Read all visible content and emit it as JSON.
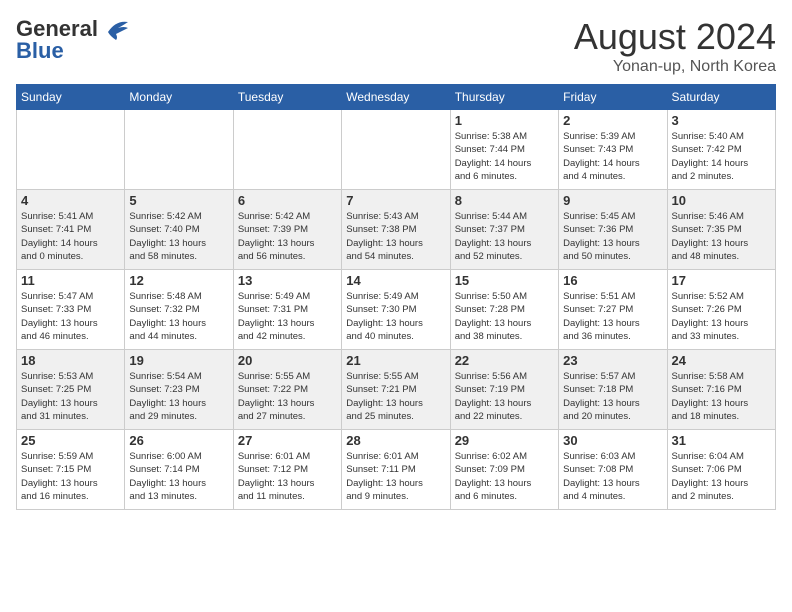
{
  "header": {
    "logo_general": "General",
    "logo_blue": "Blue",
    "month": "August 2024",
    "location": "Yonan-up, North Korea"
  },
  "weekdays": [
    "Sunday",
    "Monday",
    "Tuesday",
    "Wednesday",
    "Thursday",
    "Friday",
    "Saturday"
  ],
  "weeks": [
    [
      {
        "day": "",
        "detail": ""
      },
      {
        "day": "",
        "detail": ""
      },
      {
        "day": "",
        "detail": ""
      },
      {
        "day": "",
        "detail": ""
      },
      {
        "day": "1",
        "detail": "Sunrise: 5:38 AM\nSunset: 7:44 PM\nDaylight: 14 hours\nand 6 minutes."
      },
      {
        "day": "2",
        "detail": "Sunrise: 5:39 AM\nSunset: 7:43 PM\nDaylight: 14 hours\nand 4 minutes."
      },
      {
        "day": "3",
        "detail": "Sunrise: 5:40 AM\nSunset: 7:42 PM\nDaylight: 14 hours\nand 2 minutes."
      }
    ],
    [
      {
        "day": "4",
        "detail": "Sunrise: 5:41 AM\nSunset: 7:41 PM\nDaylight: 14 hours\nand 0 minutes."
      },
      {
        "day": "5",
        "detail": "Sunrise: 5:42 AM\nSunset: 7:40 PM\nDaylight: 13 hours\nand 58 minutes."
      },
      {
        "day": "6",
        "detail": "Sunrise: 5:42 AM\nSunset: 7:39 PM\nDaylight: 13 hours\nand 56 minutes."
      },
      {
        "day": "7",
        "detail": "Sunrise: 5:43 AM\nSunset: 7:38 PM\nDaylight: 13 hours\nand 54 minutes."
      },
      {
        "day": "8",
        "detail": "Sunrise: 5:44 AM\nSunset: 7:37 PM\nDaylight: 13 hours\nand 52 minutes."
      },
      {
        "day": "9",
        "detail": "Sunrise: 5:45 AM\nSunset: 7:36 PM\nDaylight: 13 hours\nand 50 minutes."
      },
      {
        "day": "10",
        "detail": "Sunrise: 5:46 AM\nSunset: 7:35 PM\nDaylight: 13 hours\nand 48 minutes."
      }
    ],
    [
      {
        "day": "11",
        "detail": "Sunrise: 5:47 AM\nSunset: 7:33 PM\nDaylight: 13 hours\nand 46 minutes."
      },
      {
        "day": "12",
        "detail": "Sunrise: 5:48 AM\nSunset: 7:32 PM\nDaylight: 13 hours\nand 44 minutes."
      },
      {
        "day": "13",
        "detail": "Sunrise: 5:49 AM\nSunset: 7:31 PM\nDaylight: 13 hours\nand 42 minutes."
      },
      {
        "day": "14",
        "detail": "Sunrise: 5:49 AM\nSunset: 7:30 PM\nDaylight: 13 hours\nand 40 minutes."
      },
      {
        "day": "15",
        "detail": "Sunrise: 5:50 AM\nSunset: 7:28 PM\nDaylight: 13 hours\nand 38 minutes."
      },
      {
        "day": "16",
        "detail": "Sunrise: 5:51 AM\nSunset: 7:27 PM\nDaylight: 13 hours\nand 36 minutes."
      },
      {
        "day": "17",
        "detail": "Sunrise: 5:52 AM\nSunset: 7:26 PM\nDaylight: 13 hours\nand 33 minutes."
      }
    ],
    [
      {
        "day": "18",
        "detail": "Sunrise: 5:53 AM\nSunset: 7:25 PM\nDaylight: 13 hours\nand 31 minutes."
      },
      {
        "day": "19",
        "detail": "Sunrise: 5:54 AM\nSunset: 7:23 PM\nDaylight: 13 hours\nand 29 minutes."
      },
      {
        "day": "20",
        "detail": "Sunrise: 5:55 AM\nSunset: 7:22 PM\nDaylight: 13 hours\nand 27 minutes."
      },
      {
        "day": "21",
        "detail": "Sunrise: 5:55 AM\nSunset: 7:21 PM\nDaylight: 13 hours\nand 25 minutes."
      },
      {
        "day": "22",
        "detail": "Sunrise: 5:56 AM\nSunset: 7:19 PM\nDaylight: 13 hours\nand 22 minutes."
      },
      {
        "day": "23",
        "detail": "Sunrise: 5:57 AM\nSunset: 7:18 PM\nDaylight: 13 hours\nand 20 minutes."
      },
      {
        "day": "24",
        "detail": "Sunrise: 5:58 AM\nSunset: 7:16 PM\nDaylight: 13 hours\nand 18 minutes."
      }
    ],
    [
      {
        "day": "25",
        "detail": "Sunrise: 5:59 AM\nSunset: 7:15 PM\nDaylight: 13 hours\nand 16 minutes."
      },
      {
        "day": "26",
        "detail": "Sunrise: 6:00 AM\nSunset: 7:14 PM\nDaylight: 13 hours\nand 13 minutes."
      },
      {
        "day": "27",
        "detail": "Sunrise: 6:01 AM\nSunset: 7:12 PM\nDaylight: 13 hours\nand 11 minutes."
      },
      {
        "day": "28",
        "detail": "Sunrise: 6:01 AM\nSunset: 7:11 PM\nDaylight: 13 hours\nand 9 minutes."
      },
      {
        "day": "29",
        "detail": "Sunrise: 6:02 AM\nSunset: 7:09 PM\nDaylight: 13 hours\nand 6 minutes."
      },
      {
        "day": "30",
        "detail": "Sunrise: 6:03 AM\nSunset: 7:08 PM\nDaylight: 13 hours\nand 4 minutes."
      },
      {
        "day": "31",
        "detail": "Sunrise: 6:04 AM\nSunset: 7:06 PM\nDaylight: 13 hours\nand 2 minutes."
      }
    ]
  ]
}
